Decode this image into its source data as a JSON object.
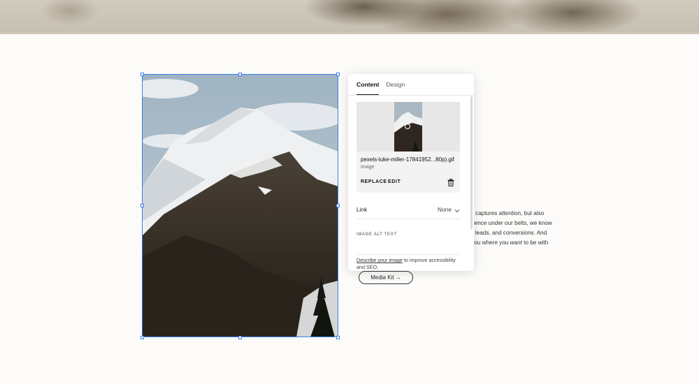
{
  "panel": {
    "tabs": [
      {
        "label": "Content",
        "active": true
      },
      {
        "label": "Design",
        "active": false
      }
    ],
    "file": {
      "name": "pexels-luke-miller-17841952...80p).gif",
      "type": "Image",
      "replace_label": "REPLACE",
      "edit_label": "EDIT",
      "delete_icon": "trash-icon"
    },
    "link": {
      "label": "Link",
      "value": "None",
      "icon": "chevron-down-icon"
    },
    "alt_text": {
      "label": "IMAGE ALT TEXT",
      "value": "",
      "help_link": "Describe your image",
      "help_rest": " to improve accessibility and SEO."
    }
  },
  "paragraph": {
    "line1": "r captures attention, but also",
    "line2": "perience under our belts, we know",
    "line3": "ffic, leads, and conversions. And",
    "line4_before": "et you where you ",
    "line4_em": "want",
    "line4_after": " to be with"
  },
  "media_button": {
    "label": "Media Kit →"
  },
  "colors": {
    "selection": "#3f7ee8",
    "page_bg": "#fcfbf9",
    "panel_bg": "#ffffff"
  }
}
